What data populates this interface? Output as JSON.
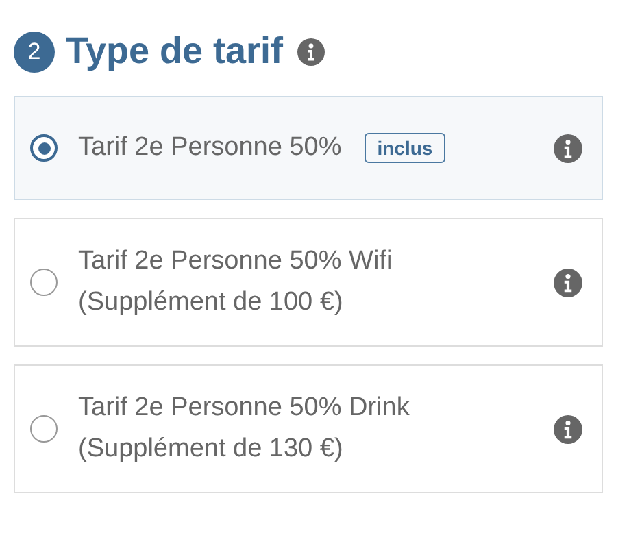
{
  "section": {
    "step": "2",
    "title": "Type de tarif"
  },
  "options": [
    {
      "name": "Tarif 2e Personne 50%",
      "badge": "inclus",
      "selected": true
    },
    {
      "name": "Tarif 2e Personne 50% Wifi",
      "note": "(Supplément de 100 €)",
      "selected": false
    },
    {
      "name": "Tarif 2e Personne 50% Drink",
      "note": "(Supplément de 130 €)",
      "selected": false
    }
  ]
}
